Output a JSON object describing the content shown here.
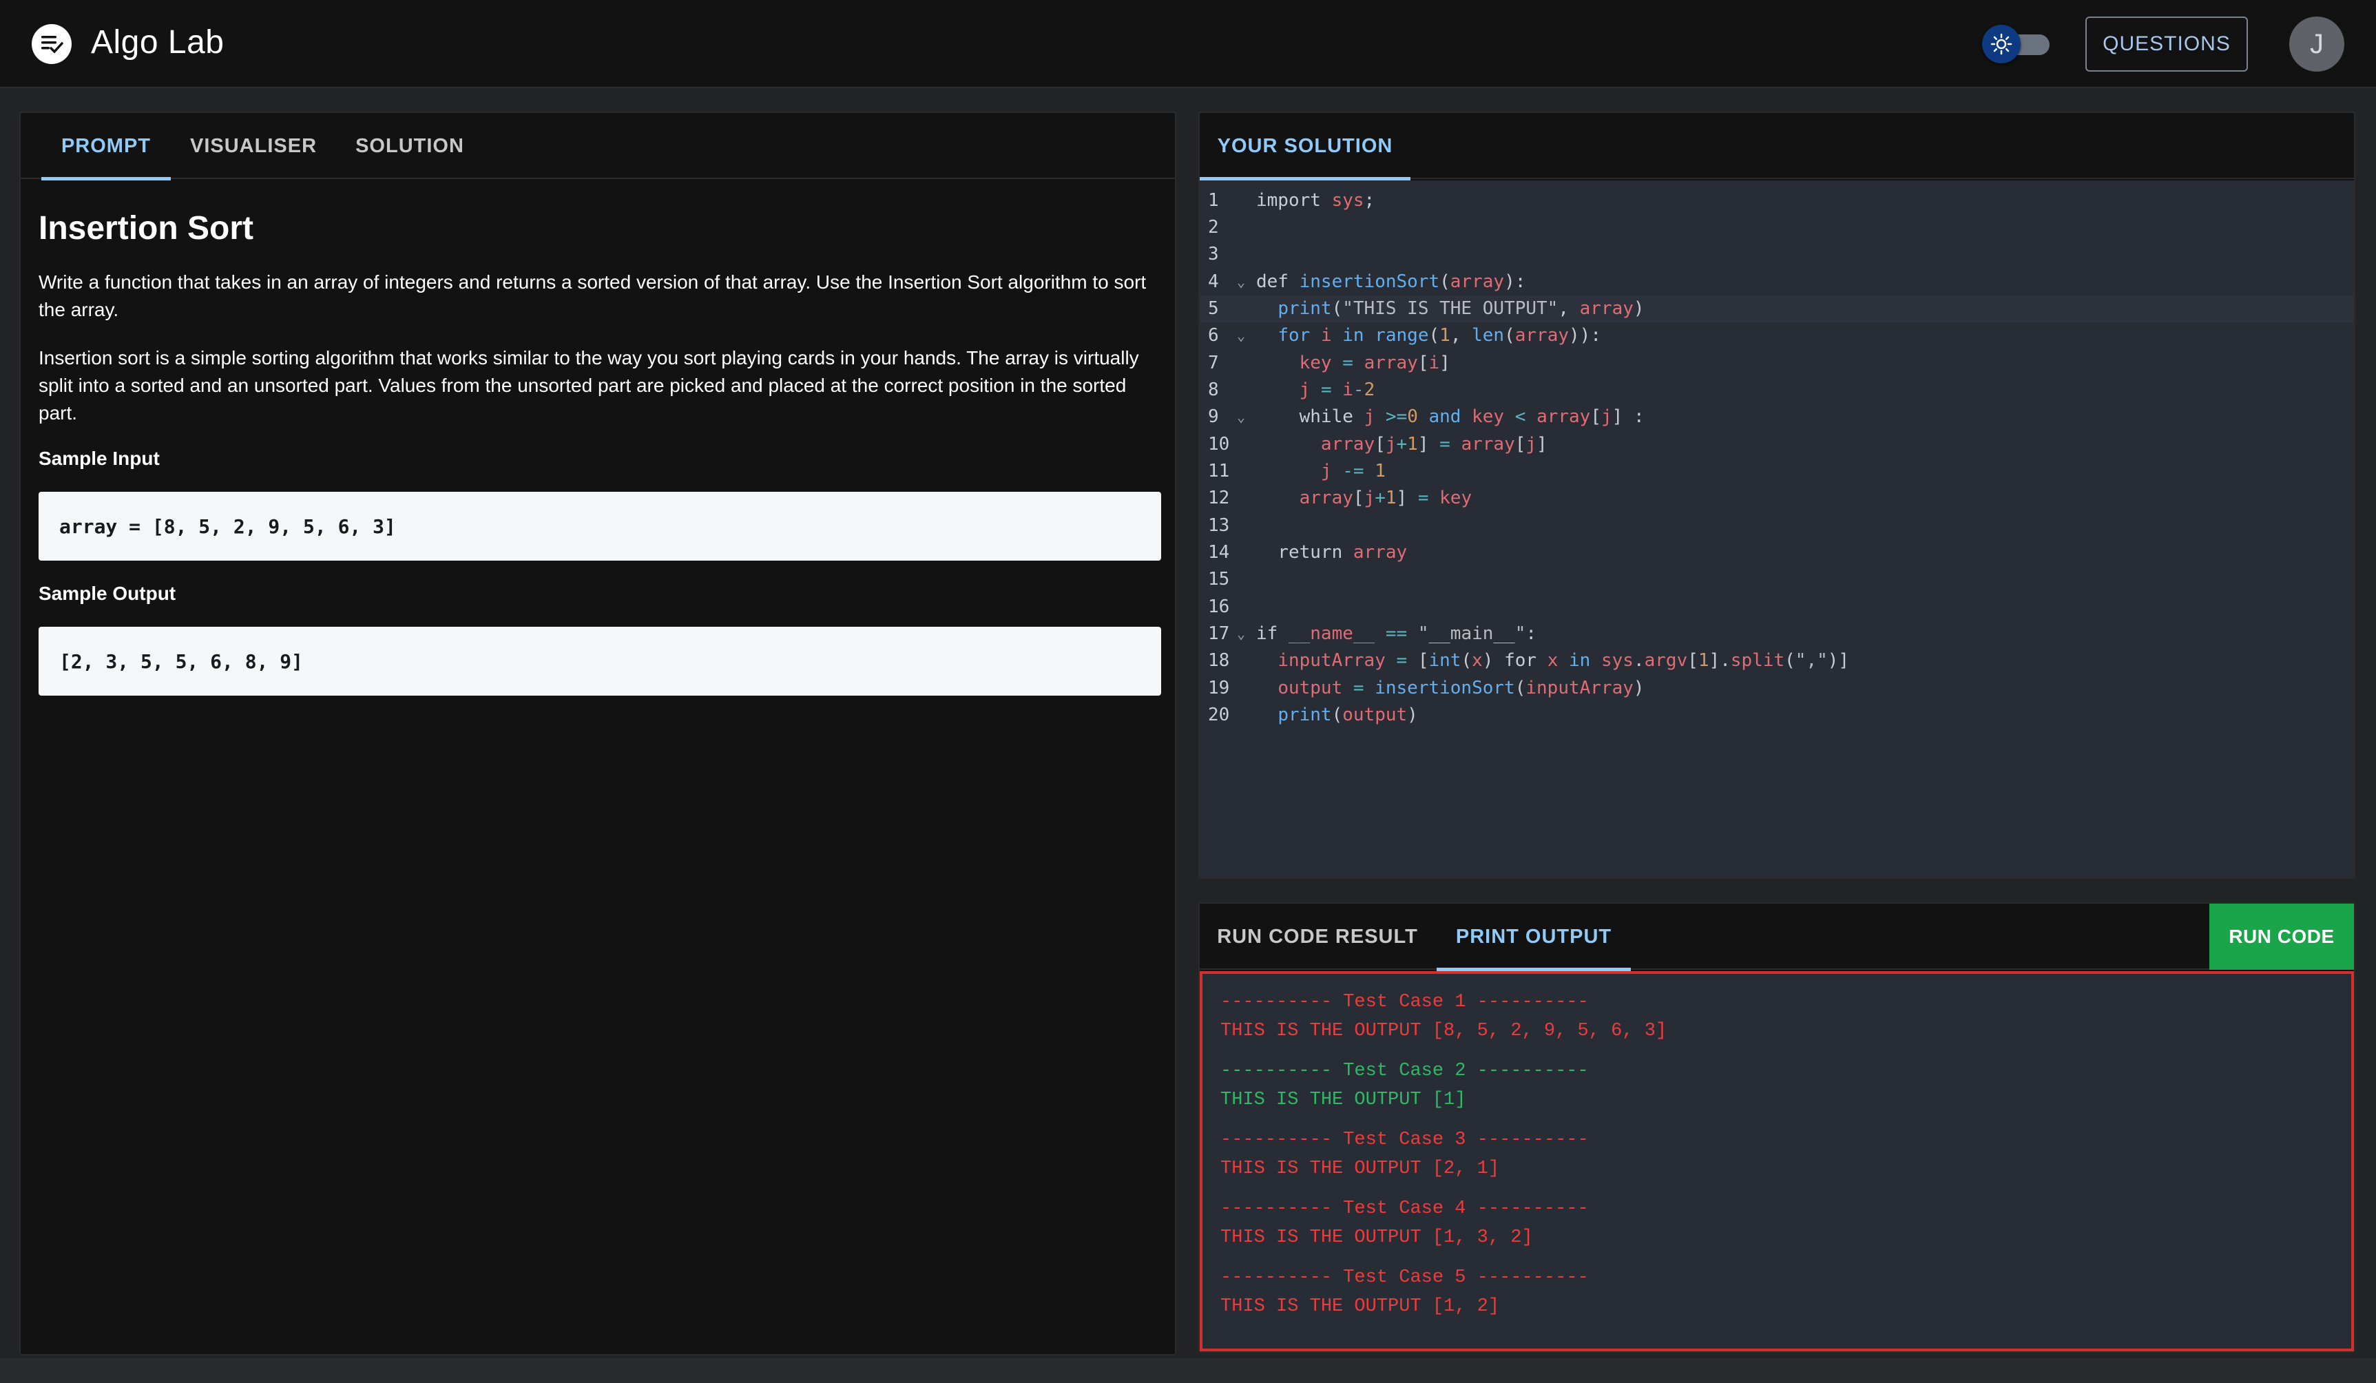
{
  "header": {
    "app_title": "Algo Lab",
    "questions_label": "QUESTIONS",
    "avatar_initial": "J"
  },
  "prompt_panel": {
    "tabs": [
      {
        "label": "PROMPT",
        "active": true
      },
      {
        "label": "VISUALISER",
        "active": false
      },
      {
        "label": "SOLUTION",
        "active": false
      }
    ],
    "title": "Insertion Sort",
    "paragraph_1": "Write a function that takes in an array of integers and returns a sorted version of that array. Use the Insertion Sort algorithm to sort the array.",
    "paragraph_2": "Insertion sort is a simple sorting algorithm that works similar to the way you sort playing cards in your hands. The array is virtually split into a sorted and an unsorted part. Values from the unsorted part are picked and placed at the correct position in the sorted part.",
    "sample_input_label": "Sample Input",
    "sample_input": "array = [8, 5, 2, 9, 5, 6, 3]",
    "sample_output_label": "Sample Output",
    "sample_output": "[2, 3, 5, 5, 6, 8, 9]"
  },
  "editor_panel": {
    "tab_label": "YOUR SOLUTION",
    "line_numbers": [
      "1",
      "2",
      "3",
      "4",
      "5",
      "6",
      "7",
      "8",
      "9",
      "10",
      "11",
      "12",
      "13",
      "14",
      "15",
      "16",
      "17",
      "18",
      "19",
      "20"
    ]
  },
  "output_panel": {
    "tabs": [
      {
        "label": "RUN CODE RESULT",
        "active": false
      },
      {
        "label": "PRINT OUTPUT",
        "active": true
      }
    ],
    "run_button_label": "RUN CODE",
    "test_cases": [
      {
        "header": "---------- Test Case 1 ----------",
        "output": "THIS IS THE OUTPUT [8, 5, 2, 9, 5, 6, 3]",
        "status": "fail"
      },
      {
        "header": "---------- Test Case 2 ----------",
        "output": "THIS IS THE OUTPUT [1]",
        "status": "pass"
      },
      {
        "header": "---------- Test Case 3 ----------",
        "output": "THIS IS THE OUTPUT [2, 1]",
        "status": "fail"
      },
      {
        "header": "---------- Test Case 4 ----------",
        "output": "THIS IS THE OUTPUT [1, 3, 2]",
        "status": "fail"
      },
      {
        "header": "---------- Test Case 5 ----------",
        "output": "THIS IS THE OUTPUT [1, 2]",
        "status": "fail"
      }
    ]
  },
  "colors": {
    "accent": "#90caf9",
    "run_button": "#1aa54a",
    "fail": "#ef3b3b",
    "pass": "#2fb866",
    "editor_bg": "#282c34"
  },
  "icons": {
    "logo": "checklist-icon",
    "theme": "sun-icon",
    "fold": "chevron-down-icon"
  }
}
